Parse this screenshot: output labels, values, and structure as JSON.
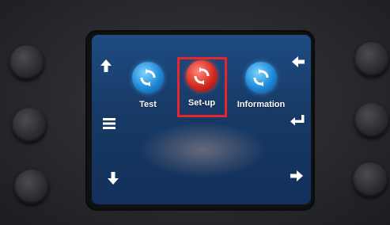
{
  "apps": [
    {
      "label": "Test",
      "icon": "refresh-icon",
      "color": "#1e88d8",
      "selected": false
    },
    {
      "label": "Set-up",
      "icon": "refresh-icon",
      "color": "#d62a1f",
      "selected": true
    },
    {
      "label": "Information",
      "icon": "refresh-icon",
      "color": "#1e88d8",
      "selected": false
    }
  ],
  "nav_icons": {
    "left_top": "arrow-up-icon",
    "left_middle": "menu-icon",
    "left_bottom": "arrow-down-icon",
    "right_top": "arrow-left-icon",
    "right_middle": "enter-icon",
    "right_bottom": "arrow-right-icon"
  },
  "highlight_color": "#e8252d",
  "screen_color": "#1f4c83"
}
